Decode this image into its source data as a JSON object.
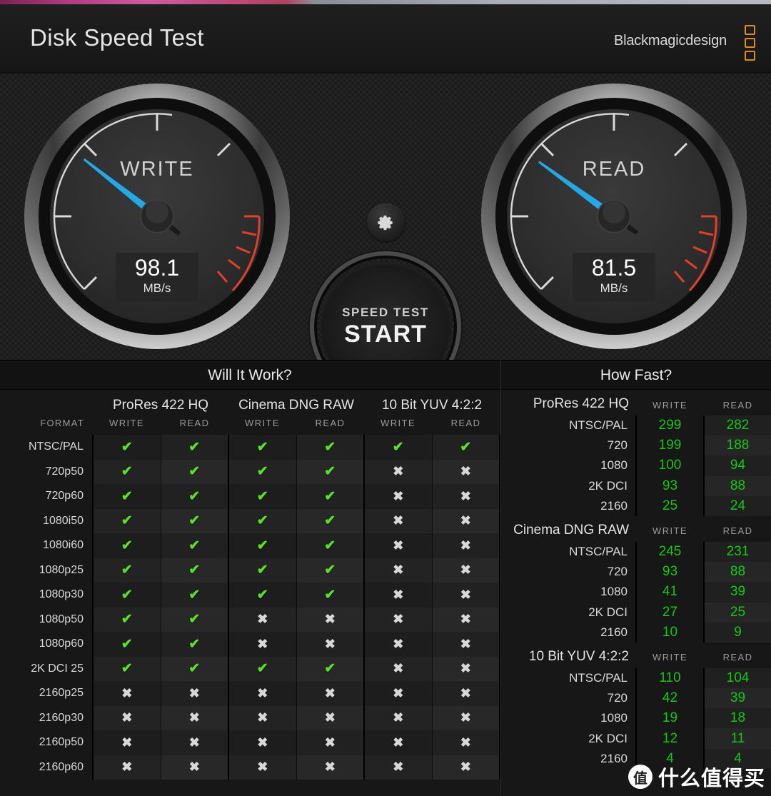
{
  "window": {
    "close_label": "✕",
    "accent_top_left": "#b03a80",
    "accent_top_right": "#b7bac2"
  },
  "header": {
    "title": "Disk Speed Test",
    "brand": "Blackmagicdesign",
    "brand_color": "#e08a1e"
  },
  "gauges": {
    "write": {
      "label": "WRITE",
      "value": "98.1",
      "unit": "MB/s",
      "needle_angle_deg": 218,
      "needle_color": "#22a9e8",
      "redzone_color": "#e0402a"
    },
    "read": {
      "label": "READ",
      "value": "81.5",
      "unit": "MB/s",
      "needle_angle_deg": 216,
      "needle_color": "#22a9e8",
      "redzone_color": "#e0402a"
    }
  },
  "controls": {
    "gear_icon": "gear-icon",
    "start_top_label": "SPEED TEST",
    "start_main_label": "START"
  },
  "will_it_work": {
    "title": "Will It Work?",
    "format_header": "FORMAT",
    "codec_groups": [
      "ProRes 422 HQ",
      "Cinema DNG RAW",
      "10 Bit YUV 4:2:2"
    ],
    "sub_headers": [
      "WRITE",
      "READ"
    ],
    "ok_glyph": "✔",
    "no_glyph": "✖",
    "ok_color": "#59e028",
    "no_color": "#d8d8d8",
    "rows": [
      {
        "format": "NTSC/PAL",
        "cells": [
          true,
          true,
          true,
          true,
          true,
          true
        ]
      },
      {
        "format": "720p50",
        "cells": [
          true,
          true,
          true,
          true,
          false,
          false
        ]
      },
      {
        "format": "720p60",
        "cells": [
          true,
          true,
          true,
          true,
          false,
          false
        ]
      },
      {
        "format": "1080i50",
        "cells": [
          true,
          true,
          true,
          true,
          false,
          false
        ]
      },
      {
        "format": "1080i60",
        "cells": [
          true,
          true,
          true,
          true,
          false,
          false
        ]
      },
      {
        "format": "1080p25",
        "cells": [
          true,
          true,
          true,
          true,
          false,
          false
        ]
      },
      {
        "format": "1080p30",
        "cells": [
          true,
          true,
          true,
          true,
          false,
          false
        ]
      },
      {
        "format": "1080p50",
        "cells": [
          true,
          true,
          false,
          false,
          false,
          false
        ]
      },
      {
        "format": "1080p60",
        "cells": [
          true,
          true,
          false,
          false,
          false,
          false
        ]
      },
      {
        "format": "2K DCI 25",
        "cells": [
          true,
          true,
          true,
          true,
          false,
          false
        ]
      },
      {
        "format": "2160p25",
        "cells": [
          false,
          false,
          false,
          false,
          false,
          false
        ]
      },
      {
        "format": "2160p30",
        "cells": [
          false,
          false,
          false,
          false,
          false,
          false
        ]
      },
      {
        "format": "2160p50",
        "cells": [
          false,
          false,
          false,
          false,
          false,
          false
        ]
      },
      {
        "format": "2160p60",
        "cells": [
          false,
          false,
          false,
          false,
          false,
          false
        ]
      }
    ]
  },
  "how_fast": {
    "title": "How Fast?",
    "sub_headers": [
      "WRITE",
      "READ"
    ],
    "value_color": "#14c814",
    "sections": [
      {
        "name": "ProRes 422 HQ",
        "rows": [
          {
            "res": "NTSC/PAL",
            "write": "299",
            "read": "282"
          },
          {
            "res": "720",
            "write": "199",
            "read": "188"
          },
          {
            "res": "1080",
            "write": "100",
            "read": "94"
          },
          {
            "res": "2K DCI",
            "write": "93",
            "read": "88"
          },
          {
            "res": "2160",
            "write": "25",
            "read": "24"
          }
        ]
      },
      {
        "name": "Cinema DNG RAW",
        "rows": [
          {
            "res": "NTSC/PAL",
            "write": "245",
            "read": "231"
          },
          {
            "res": "720",
            "write": "93",
            "read": "88"
          },
          {
            "res": "1080",
            "write": "41",
            "read": "39"
          },
          {
            "res": "2K DCI",
            "write": "27",
            "read": "25"
          },
          {
            "res": "2160",
            "write": "10",
            "read": "9"
          }
        ]
      },
      {
        "name": "10 Bit YUV 4:2:2",
        "rows": [
          {
            "res": "NTSC/PAL",
            "write": "110",
            "read": "104"
          },
          {
            "res": "720",
            "write": "42",
            "read": "39"
          },
          {
            "res": "1080",
            "write": "19",
            "read": "18"
          },
          {
            "res": "2K DCI",
            "write": "12",
            "read": "11"
          },
          {
            "res": "2160",
            "write": "4",
            "read": "4"
          }
        ]
      }
    ]
  },
  "watermark": {
    "badge": "值",
    "text": "什么值得买"
  }
}
